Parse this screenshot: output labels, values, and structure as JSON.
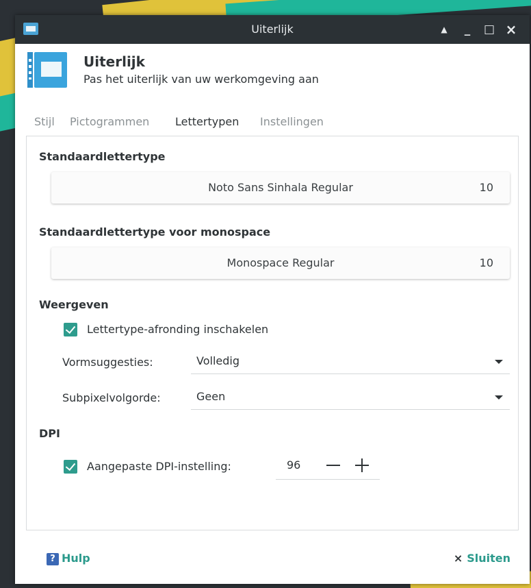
{
  "window": {
    "title": "Uiterlijk",
    "controls": {
      "shade": "▲",
      "minimize": "_",
      "maximize": "□",
      "close": "×"
    }
  },
  "header": {
    "title": "Uiterlijk",
    "subtitle": "Pas het uiterlijk van uw werkomgeving aan"
  },
  "tabs": [
    {
      "label": "Stijl",
      "active": false
    },
    {
      "label": "Pictogrammen",
      "active": false
    },
    {
      "label": "Lettertypen",
      "active": true
    },
    {
      "label": "Instellingen",
      "active": false
    }
  ],
  "fonts": {
    "default_heading": "Standaardlettertype",
    "default_font": {
      "name": "Noto Sans Sinhala Regular",
      "size": "10"
    },
    "mono_heading": "Standaardlettertype voor monospace",
    "mono_font": {
      "name": "Monospace Regular",
      "size": "10"
    }
  },
  "rendering": {
    "heading": "Weergeven",
    "antialias": {
      "label": "Lettertype-afronding inschakelen",
      "checked": true
    },
    "hinting": {
      "label": "Vormsuggesties:",
      "value": "Volledig"
    },
    "subpixel": {
      "label": "Subpixelvolgorde:",
      "value": "Geen"
    }
  },
  "dpi": {
    "heading": "DPI",
    "custom": {
      "label": "Aangepaste DPI-instelling:",
      "checked": true,
      "value": "96"
    }
  },
  "footer": {
    "help_icon": "?",
    "help_label": "Hulp",
    "close_icon": "×",
    "close_label": "Sluiten"
  },
  "colors": {
    "accent": "#2e9c8d",
    "titlebar": "#2b3135",
    "header_icon": "#3aa4dd",
    "help_icon": "#3b68b5"
  }
}
